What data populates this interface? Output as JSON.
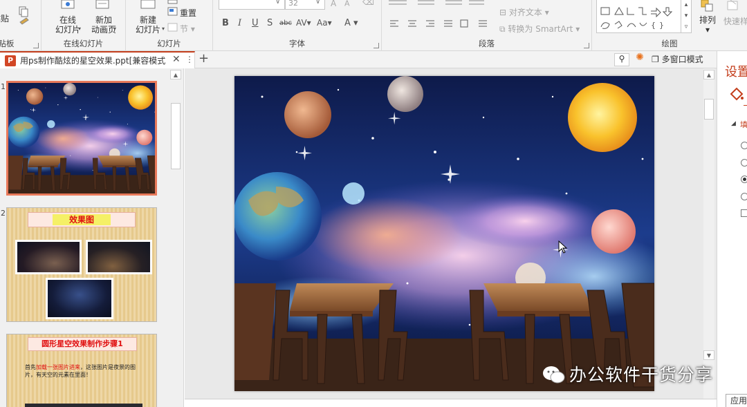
{
  "ribbon": {
    "clipboard": {
      "paste_label": "粘贴",
      "group_label": "剪贴板"
    },
    "online_slides": {
      "online_slide_label": "在线\n幻灯片",
      "new_anim_label": "新加\n动画页",
      "group_label": "在线幻灯片"
    },
    "slides": {
      "new_slide_label": "新建\n幻灯片",
      "reset_label": "重置",
      "section_label": "节",
      "group_label": "幻灯片"
    },
    "font": {
      "size_value": "32",
      "group_label": "字体"
    },
    "paragraph": {
      "align_text_label": "对齐文本",
      "smartart_label": "转换为 SmartArt",
      "group_label": "段落"
    },
    "drawing": {
      "arrange_label": "排列",
      "quick_styles_label": "快速样",
      "group_label": "绘图"
    }
  },
  "tabbar": {
    "doc_title": "用ps制作酷炫的星空效果.ppt[兼容模式",
    "multi_window_label": "多窗口模式"
  },
  "thumbnails": [
    {
      "number": "1",
      "title": ""
    },
    {
      "number": "2",
      "title": "效果图"
    },
    {
      "number": "3",
      "title": "圆形星空效果制作步骤1",
      "body": "首先",
      "body_highlight": "加载一张图片进来",
      "body_rest": "，这张图片是夜景的图片，有天空的元素在里面！"
    }
  ],
  "right_pane": {
    "title": "设置",
    "apply_label": "应用"
  },
  "watermark": "办公软件干货分享",
  "colors": {
    "accent": "#c43e1c",
    "ribbon_bg": "#f3f3f3",
    "editor_bg": "#e9e9e9"
  }
}
